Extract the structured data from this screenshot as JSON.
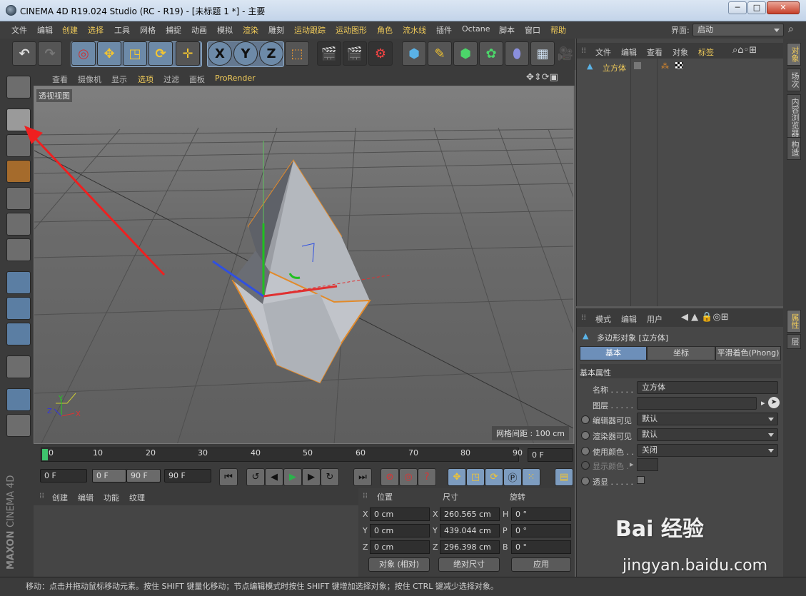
{
  "window": {
    "title": "CINEMA 4D R19.024 Studio (RC - R19) - [未标题 1 *] - 主要",
    "min": "─",
    "max": "□",
    "close": "✕"
  },
  "menubar": {
    "items": [
      "文件",
      "编辑",
      "创建",
      "选择",
      "工具",
      "网格",
      "捕捉",
      "动画",
      "模拟",
      "渲染",
      "雕刻",
      "运动跟踪",
      "运动图形",
      "角色",
      "流水线",
      "插件",
      "Octane",
      "脚本",
      "窗口",
      "帮助"
    ],
    "layout_label": "界面:",
    "layout_value": "启动"
  },
  "toolbar": {
    "axis_x": "X",
    "axis_y": "Y",
    "axis_z": "Z"
  },
  "viewport": {
    "menu": [
      "查看",
      "摄像机",
      "显示",
      "选项",
      "过滤",
      "面板",
      "ProRender"
    ],
    "view_label": "透视视图",
    "grid_info": "网格间距 : 100 cm",
    "axis_y": "Y",
    "axis_x": "X",
    "axis_z": "Z"
  },
  "timeline": {
    "ticks": [
      "0",
      "10",
      "20",
      "30",
      "40",
      "50",
      "60",
      "70",
      "80",
      "90"
    ],
    "current_frame": "0 F",
    "start": "0 F",
    "range_start": "0 F",
    "range_end": "90 F",
    "end": "90 F"
  },
  "materials": {
    "menu": [
      "创建",
      "编辑",
      "功能",
      "纹理"
    ]
  },
  "coords": {
    "headers": [
      "位置",
      "尺寸",
      "旋转"
    ],
    "rows": [
      {
        "pl": "X",
        "pv": "0 cm",
        "sl": "X",
        "sv": "260.565 cm",
        "rl": "H",
        "rv": "0 °"
      },
      {
        "pl": "Y",
        "pv": "0 cm",
        "sl": "Y",
        "sv": "439.044 cm",
        "rl": "P",
        "rv": "0 °"
      },
      {
        "pl": "Z",
        "pv": "0 cm",
        "sl": "Z",
        "sv": "296.398 cm",
        "rl": "B",
        "rv": "0 °"
      }
    ],
    "mode": "对象 (相对)",
    "size_mode": "绝对尺寸",
    "apply": "应用"
  },
  "objects": {
    "menu": [
      "文件",
      "编辑",
      "查看",
      "对象",
      "标签"
    ],
    "item": "立方体"
  },
  "attributes": {
    "menu": [
      "模式",
      "编辑",
      "用户"
    ],
    "object_title": "多边形对象 [立方体]",
    "tabs": [
      "基本",
      "坐标",
      "平滑着色(Phong)"
    ],
    "section": "基本属性",
    "fields": [
      {
        "label": "名称 . . . . .",
        "value": "立方体"
      },
      {
        "label": "图层 . . . . .",
        "value": ""
      },
      {
        "label": "编辑器可见",
        "value": "默认"
      },
      {
        "label": "渲染器可见",
        "value": "默认"
      },
      {
        "label": "使用颜色 . .",
        "value": "关闭"
      },
      {
        "label": "显示颜色 .",
        "value": ""
      },
      {
        "label": "透显 . . . . .",
        "value": ""
      }
    ]
  },
  "side_tabs": [
    "对象",
    "场次",
    "内容浏览器",
    "构造"
  ],
  "side_tabs2": [
    "属性",
    "层"
  ],
  "status": "移动：点击并拖动鼠标移动元素。按住 SHIFT 键量化移动；节点编辑模式时按住 SHIFT 键增加选择对象；按住 CTRL 键减少选择对象。",
  "branding": {
    "maxon": "MAXON",
    "product": "CINEMA 4D"
  },
  "watermark": {
    "brand": "Bai 经验",
    "url": "jingyan.baidu.com"
  }
}
